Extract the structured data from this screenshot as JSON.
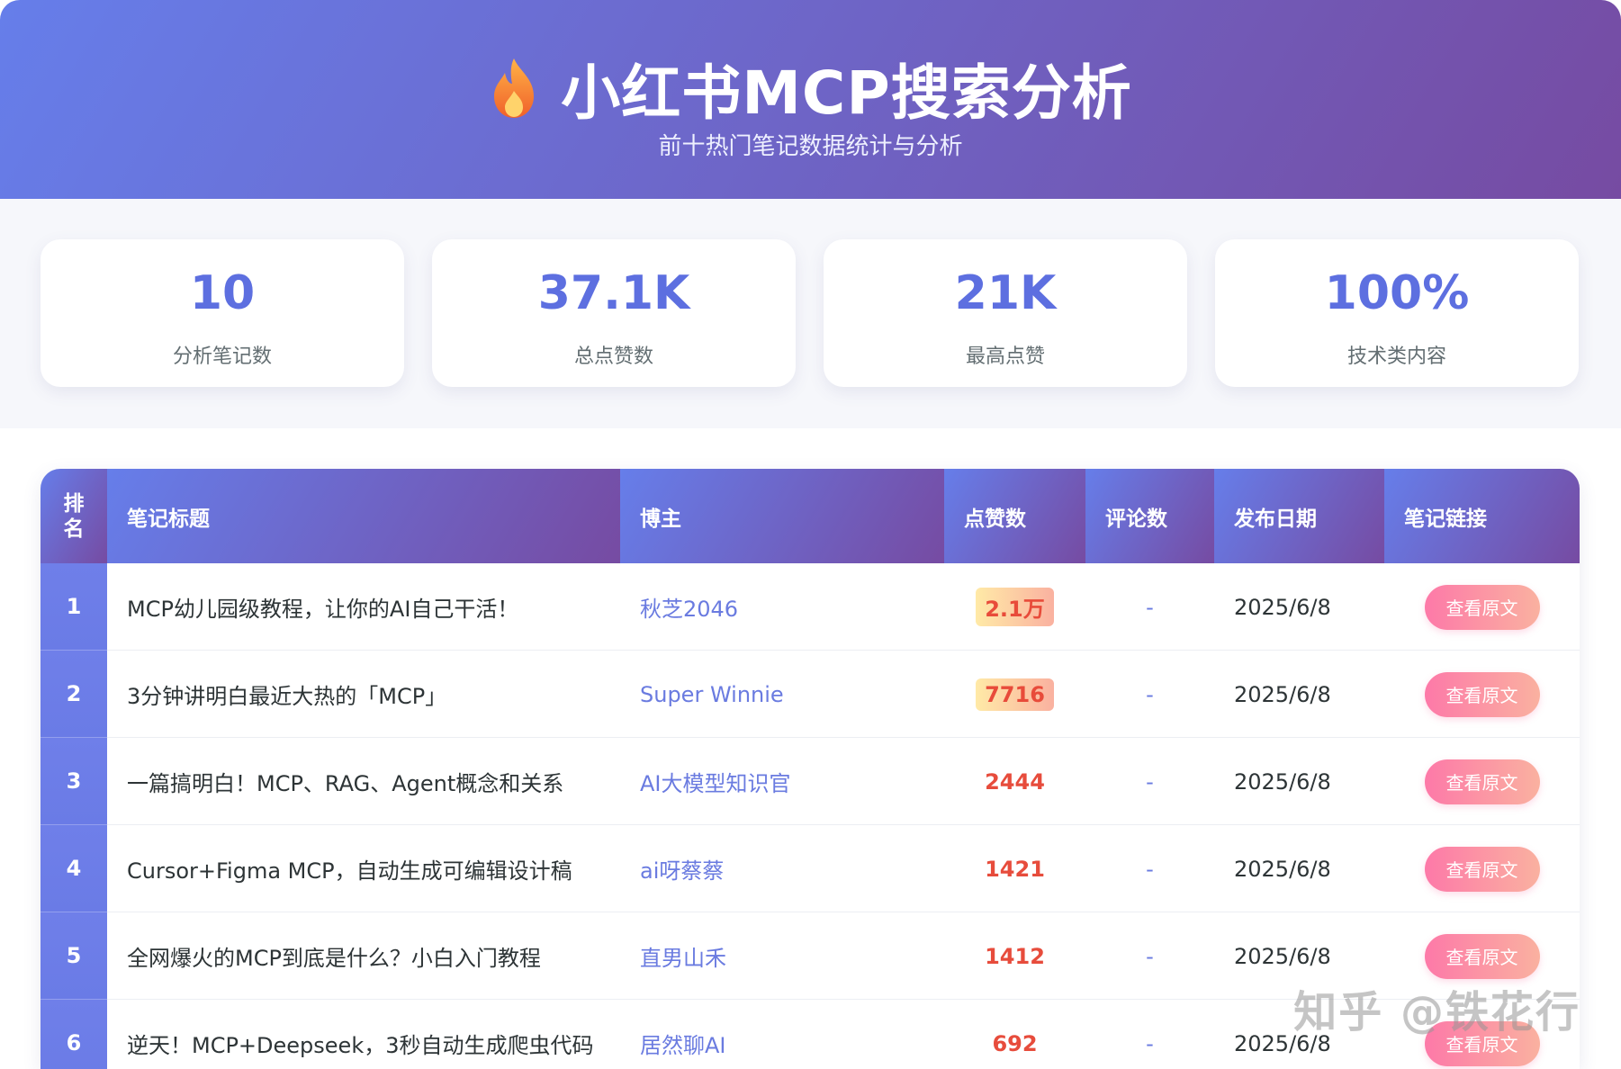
{
  "header": {
    "title": "小红书MCP搜索分析",
    "subtitle": "前十热门笔记数据统计与分析"
  },
  "stats": [
    {
      "value": "10",
      "label": "分析笔记数"
    },
    {
      "value": "37.1K",
      "label": "总点赞数"
    },
    {
      "value": "21K",
      "label": "最高点赞"
    },
    {
      "value": "100%",
      "label": "技术类内容"
    }
  ],
  "table": {
    "headers": {
      "rank_line1": "排",
      "rank_line2": "名",
      "title": "笔记标题",
      "author": "博主",
      "likes": "点赞数",
      "comments": "评论数",
      "date": "发布日期",
      "link": "笔记链接"
    },
    "rows": [
      {
        "rank": "1",
        "title": "MCP幼儿园级教程，让你的AI自己干活！",
        "author": "秋芝2046",
        "likes": "2.1万",
        "comments": "-",
        "date": "2025/6/8",
        "link_label": "查看原文"
      },
      {
        "rank": "2",
        "title": "3分钟讲明白最近大热的「MCP」",
        "author": "Super Winnie",
        "likes": "7716",
        "comments": "-",
        "date": "2025/6/8",
        "link_label": "查看原文"
      },
      {
        "rank": "3",
        "title": "一篇搞明白！MCP、RAG、Agent概念和关系",
        "author": "AI大模型知识官",
        "likes": "2444",
        "comments": "-",
        "date": "2025/6/8",
        "link_label": "查看原文"
      },
      {
        "rank": "4",
        "title": "Cursor+Figma MCP，自动生成可编辑设计稿",
        "author": "ai呀蔡蔡",
        "likes": "1421",
        "comments": "-",
        "date": "2025/6/8",
        "link_label": "查看原文"
      },
      {
        "rank": "5",
        "title": "全网爆火的MCP到底是什么？小白入门教程",
        "author": "直男山禾",
        "likes": "1412",
        "comments": "-",
        "date": "2025/6/8",
        "link_label": "查看原文"
      },
      {
        "rank": "6",
        "title": "逆天！MCP+Deepseek，3秒自动生成爬虫代码",
        "author": "居然聊AI",
        "likes": "692",
        "comments": "-",
        "date": "2025/6/8",
        "link_label": "查看原文"
      }
    ]
  },
  "watermark": "知乎 @铁花行",
  "colors": {
    "gradient_start": "#667eea",
    "gradient_end": "#764ba2",
    "accent_blue": "#5d6fe0",
    "likes_red": "#e74c3c",
    "button_pink": "#fd79a8"
  },
  "icons": {
    "title_icon": "fire-icon"
  }
}
